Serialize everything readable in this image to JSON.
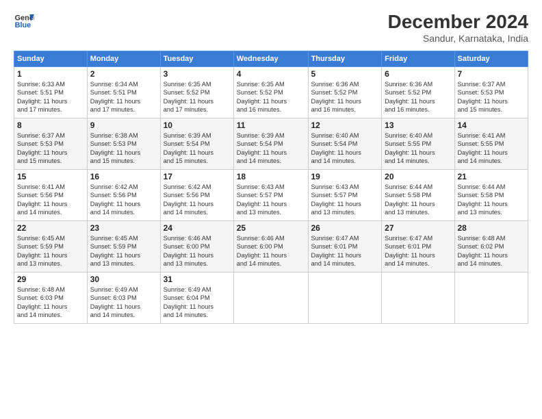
{
  "logo": {
    "line1": "General",
    "line2": "Blue"
  },
  "title": "December 2024",
  "subtitle": "Sandur, Karnataka, India",
  "weekdays": [
    "Sunday",
    "Monday",
    "Tuesday",
    "Wednesday",
    "Thursday",
    "Friday",
    "Saturday"
  ],
  "weeks": [
    [
      {
        "day": "1",
        "sunrise": "6:33 AM",
        "sunset": "5:51 PM",
        "daylight": "11 hours and 17 minutes."
      },
      {
        "day": "2",
        "sunrise": "6:34 AM",
        "sunset": "5:51 PM",
        "daylight": "11 hours and 17 minutes."
      },
      {
        "day": "3",
        "sunrise": "6:35 AM",
        "sunset": "5:52 PM",
        "daylight": "11 hours and 17 minutes."
      },
      {
        "day": "4",
        "sunrise": "6:35 AM",
        "sunset": "5:52 PM",
        "daylight": "11 hours and 16 minutes."
      },
      {
        "day": "5",
        "sunrise": "6:36 AM",
        "sunset": "5:52 PM",
        "daylight": "11 hours and 16 minutes."
      },
      {
        "day": "6",
        "sunrise": "6:36 AM",
        "sunset": "5:52 PM",
        "daylight": "11 hours and 16 minutes."
      },
      {
        "day": "7",
        "sunrise": "6:37 AM",
        "sunset": "5:53 PM",
        "daylight": "11 hours and 15 minutes."
      }
    ],
    [
      {
        "day": "8",
        "sunrise": "6:37 AM",
        "sunset": "5:53 PM",
        "daylight": "11 hours and 15 minutes."
      },
      {
        "day": "9",
        "sunrise": "6:38 AM",
        "sunset": "5:53 PM",
        "daylight": "11 hours and 15 minutes."
      },
      {
        "day": "10",
        "sunrise": "6:39 AM",
        "sunset": "5:54 PM",
        "daylight": "11 hours and 15 minutes."
      },
      {
        "day": "11",
        "sunrise": "6:39 AM",
        "sunset": "5:54 PM",
        "daylight": "11 hours and 14 minutes."
      },
      {
        "day": "12",
        "sunrise": "6:40 AM",
        "sunset": "5:54 PM",
        "daylight": "11 hours and 14 minutes."
      },
      {
        "day": "13",
        "sunrise": "6:40 AM",
        "sunset": "5:55 PM",
        "daylight": "11 hours and 14 minutes."
      },
      {
        "day": "14",
        "sunrise": "6:41 AM",
        "sunset": "5:55 PM",
        "daylight": "11 hours and 14 minutes."
      }
    ],
    [
      {
        "day": "15",
        "sunrise": "6:41 AM",
        "sunset": "5:56 PM",
        "daylight": "11 hours and 14 minutes."
      },
      {
        "day": "16",
        "sunrise": "6:42 AM",
        "sunset": "5:56 PM",
        "daylight": "11 hours and 14 minutes."
      },
      {
        "day": "17",
        "sunrise": "6:42 AM",
        "sunset": "5:56 PM",
        "daylight": "11 hours and 14 minutes."
      },
      {
        "day": "18",
        "sunrise": "6:43 AM",
        "sunset": "5:57 PM",
        "daylight": "11 hours and 13 minutes."
      },
      {
        "day": "19",
        "sunrise": "6:43 AM",
        "sunset": "5:57 PM",
        "daylight": "11 hours and 13 minutes."
      },
      {
        "day": "20",
        "sunrise": "6:44 AM",
        "sunset": "5:58 PM",
        "daylight": "11 hours and 13 minutes."
      },
      {
        "day": "21",
        "sunrise": "6:44 AM",
        "sunset": "5:58 PM",
        "daylight": "11 hours and 13 minutes."
      }
    ],
    [
      {
        "day": "22",
        "sunrise": "6:45 AM",
        "sunset": "5:59 PM",
        "daylight": "11 hours and 13 minutes."
      },
      {
        "day": "23",
        "sunrise": "6:45 AM",
        "sunset": "5:59 PM",
        "daylight": "11 hours and 13 minutes."
      },
      {
        "day": "24",
        "sunrise": "6:46 AM",
        "sunset": "6:00 PM",
        "daylight": "11 hours and 13 minutes."
      },
      {
        "day": "25",
        "sunrise": "6:46 AM",
        "sunset": "6:00 PM",
        "daylight": "11 hours and 14 minutes."
      },
      {
        "day": "26",
        "sunrise": "6:47 AM",
        "sunset": "6:01 PM",
        "daylight": "11 hours and 14 minutes."
      },
      {
        "day": "27",
        "sunrise": "6:47 AM",
        "sunset": "6:01 PM",
        "daylight": "11 hours and 14 minutes."
      },
      {
        "day": "28",
        "sunrise": "6:48 AM",
        "sunset": "6:02 PM",
        "daylight": "11 hours and 14 minutes."
      }
    ],
    [
      {
        "day": "29",
        "sunrise": "6:48 AM",
        "sunset": "6:03 PM",
        "daylight": "11 hours and 14 minutes."
      },
      {
        "day": "30",
        "sunrise": "6:49 AM",
        "sunset": "6:03 PM",
        "daylight": "11 hours and 14 minutes."
      },
      {
        "day": "31",
        "sunrise": "6:49 AM",
        "sunset": "6:04 PM",
        "daylight": "11 hours and 14 minutes."
      },
      null,
      null,
      null,
      null
    ]
  ]
}
